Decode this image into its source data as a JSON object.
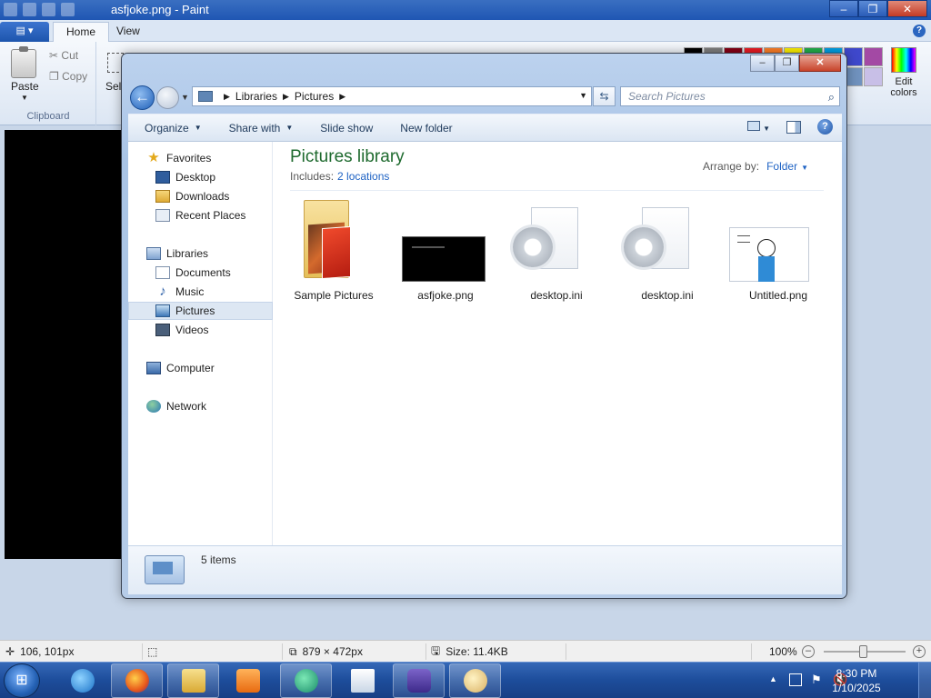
{
  "paint": {
    "title": "asfjoke.png - Paint",
    "menu_button": "▤ ▾",
    "tabs": [
      "Home",
      "View"
    ],
    "clipboard": {
      "paste": "Paste",
      "cut": "Cut",
      "copy": "Copy",
      "group_label": "Clipboard"
    },
    "select_label": "Sel",
    "edit_colors": "Edit colors",
    "palette": [
      "#000000",
      "#7f7f7f",
      "#880015",
      "#ed1c24",
      "#ff7f27",
      "#fff200",
      "#22b14c",
      "#00a2e8",
      "#3f48cc",
      "#a349a4",
      "#ffffff",
      "#c3c3c3",
      "#b97a57",
      "#ffaec9",
      "#ffc90e",
      "#efe4b0",
      "#b5e61d",
      "#99d9ea",
      "#7092be",
      "#c8bfe7"
    ],
    "status": {
      "cursor_pos": "106, 101px",
      "image_size": "879 × 472px",
      "file_size": "Size: 11.4KB",
      "zoom": "100%"
    }
  },
  "explorer": {
    "address": {
      "crumbs": [
        "Libraries",
        "Pictures"
      ]
    },
    "search_placeholder": "Search Pictures",
    "commands": {
      "organize": "Organize",
      "share_with": "Share with",
      "slide_show": "Slide show",
      "new_folder": "New folder"
    },
    "nav": {
      "favorites": "Favorites",
      "desktop": "Desktop",
      "downloads": "Downloads",
      "recent_places": "Recent Places",
      "libraries": "Libraries",
      "documents": "Documents",
      "music": "Music",
      "pictures": "Pictures",
      "videos": "Videos",
      "computer": "Computer",
      "network": "Network"
    },
    "library": {
      "title": "Pictures library",
      "includes_label": "Includes:",
      "locations_link": "2 locations",
      "arrange_label": "Arrange by:",
      "arrange_value": "Folder"
    },
    "files": [
      "Sample Pictures",
      "asfjoke.png",
      "desktop.ini",
      "desktop.ini",
      "Untitled.png"
    ],
    "item_count": "5 items"
  },
  "taskbar": {
    "clock_time": "8:30 PM",
    "clock_date": "1/10/2025"
  }
}
